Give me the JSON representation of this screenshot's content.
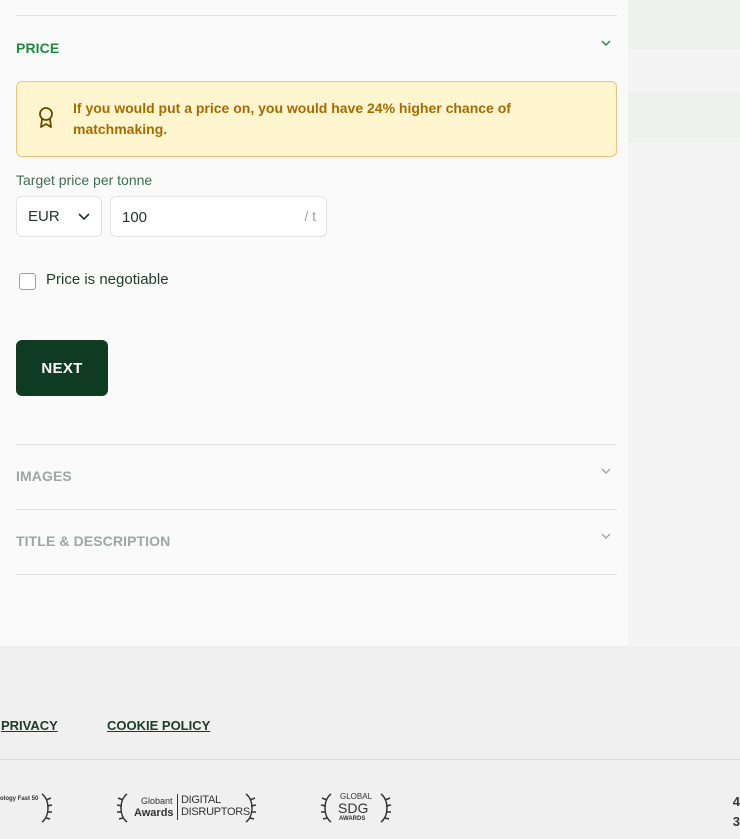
{
  "sections": {
    "price": {
      "title": "PRICE"
    },
    "images": {
      "title": "IMAGES"
    },
    "title_description": {
      "title": "TITLE & DESCRIPTION"
    }
  },
  "alert": {
    "text": "If you would put a price on, you would have 24% higher chance of matchmaking."
  },
  "price_form": {
    "label": "Target price per tonne",
    "currency": "EUR",
    "amount": "100",
    "unit": "/ t",
    "negotiable_label": "Price is negotiable",
    "negotiable_checked": false
  },
  "next_button": "NEXT",
  "footer": {
    "links": [
      "PRIVACY",
      "COOKIE POLICY"
    ],
    "awards": [
      {
        "text": "ology Fast 50"
      },
      {
        "top": "Globant",
        "bottom": "Awards",
        "right": "DIGITAL DISRUPTORS"
      },
      {
        "top": "GLOBAL",
        "mid": "SDG",
        "bottom": "AWARDS"
      }
    ],
    "right_text": [
      "4",
      "3"
    ]
  },
  "colors": {
    "accent": "#1e8a3a",
    "button": "#0e3b21",
    "alert_bg": "#fff6d0",
    "alert_text": "#a66a00"
  }
}
